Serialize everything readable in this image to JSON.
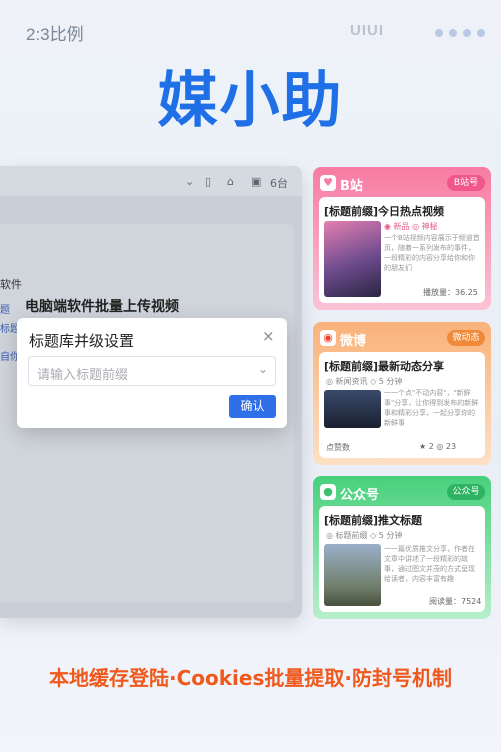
{
  "header": {
    "ratio_label": "2:3比例",
    "ui_label": "UIUI",
    "brand_title": "媒小助"
  },
  "window": {
    "toolbar_label": "6台",
    "side_text": "软件",
    "title": "电脑端软件批量上传视频",
    "side_item1": "题",
    "side_item2": "标题",
    "side_item3": "自你"
  },
  "dialog": {
    "title": "标题库并级设置",
    "close_glyph": "×",
    "input_placeholder": "请输入标题前缀",
    "chevron_glyph": "⌄",
    "confirm_label": "确认"
  },
  "cards": {
    "bilibili": {
      "platform": "B站",
      "tag": "B站号",
      "title": "[标题前缀]今日热点视频",
      "meta": "◉ 新品 ◎ 神秘",
      "text": "一个B站视频内容展示于频道首页，随着一系列发布的事件，一段精彩的内容分享给你和你的朋友们",
      "stat": "播放量：36.25"
    },
    "weibo": {
      "platform": "微博",
      "tag": "微动态",
      "title": "[标题前缀]最新动态分享",
      "meta": "◎ 新闻资讯 ◇ 5 分钟",
      "text": "一一个点\"不动内容\"，\"新鲜事\"分享，让你得到发布的新鲜事和精彩分享，一起分享你的新鲜事",
      "author": "点赞数",
      "stats": "★ 2  ◎ 23"
    },
    "wechat": {
      "platform": "公众号",
      "tag": "公众号",
      "title": "[标题前缀]推文标题",
      "meta": "◎ 标题前缀 ◇ 5 分钟",
      "text": "一一篇优质推文分享，作者在文章中讲述了一段精彩的故事，通过图文并茂的方式呈现给读者，内容丰富有趣",
      "stat": "阅读量：7524"
    }
  },
  "footer": {
    "slogan": "本地缓存登陆·Cookies批量提取·防封号机制"
  },
  "colors": {
    "brand": "#1f6fe6",
    "confirm": "#2f6fe8",
    "slogan": "#f0581c",
    "bilibili": "#f77ba3",
    "weibo": "#f9b27a",
    "wechat": "#48d07c"
  }
}
